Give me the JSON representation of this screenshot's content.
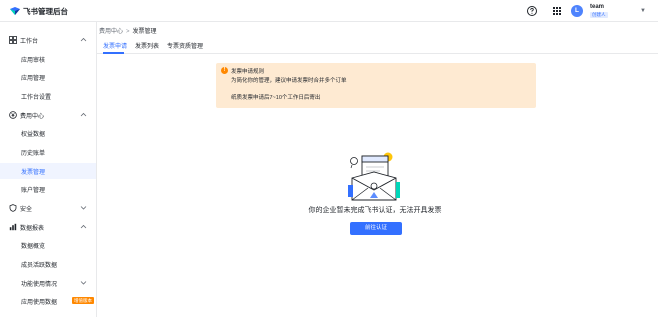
{
  "header": {
    "app_title": "飞书管理后台",
    "help_icon": "help-circle-icon",
    "apps_icon": "grid-apps-icon",
    "team": {
      "avatar_letter": "L",
      "name": "team",
      "role": "创建人"
    }
  },
  "sidebar": {
    "items": [
      {
        "label": "工作台",
        "type": "group",
        "icon": "dashboard-icon",
        "expanded": true
      },
      {
        "label": "应用审核",
        "type": "item"
      },
      {
        "label": "应用管理",
        "type": "item"
      },
      {
        "label": "工作台设置",
        "type": "item"
      },
      {
        "label": "费用中心",
        "type": "group",
        "icon": "cost-center-icon",
        "expanded": true
      },
      {
        "label": "权益数据",
        "type": "item"
      },
      {
        "label": "历史账单",
        "type": "item"
      },
      {
        "label": "发票管理",
        "type": "item",
        "active": true
      },
      {
        "label": "账户管理",
        "type": "item"
      },
      {
        "label": "安全",
        "type": "group",
        "icon": "shield-icon",
        "expanded": false
      },
      {
        "label": "数据报表",
        "type": "group",
        "icon": "report-icon",
        "expanded": true
      },
      {
        "label": "数据概览",
        "type": "item"
      },
      {
        "label": "成员活跃数据",
        "type": "item"
      },
      {
        "label": "功能使用情况",
        "type": "item",
        "expandable": true
      },
      {
        "label": "应用使用数据",
        "type": "item",
        "tag": "增值版本"
      }
    ]
  },
  "breadcrumb": {
    "parent": "费用中心",
    "separator": ">",
    "current": "发票管理"
  },
  "tabs": [
    {
      "label": "发票申请",
      "active": true
    },
    {
      "label": "发票列表",
      "active": false
    },
    {
      "label": "专票资质管理",
      "active": false
    }
  ],
  "notice": {
    "title": "发票申请规则",
    "line1": "为简化你的管理，建议申请发票时合并多个订单",
    "line2": "纸质发票申请后7~10个工作日后寄出"
  },
  "empty_state": {
    "message": "你的企业暂未完成飞书认证，无法开具发票",
    "button_label": "前往认证"
  },
  "colors": {
    "accent": "#3370ff",
    "notice_bg": "#feead2",
    "warning": "#ff8800",
    "active_bg": "#f0f4ff"
  }
}
